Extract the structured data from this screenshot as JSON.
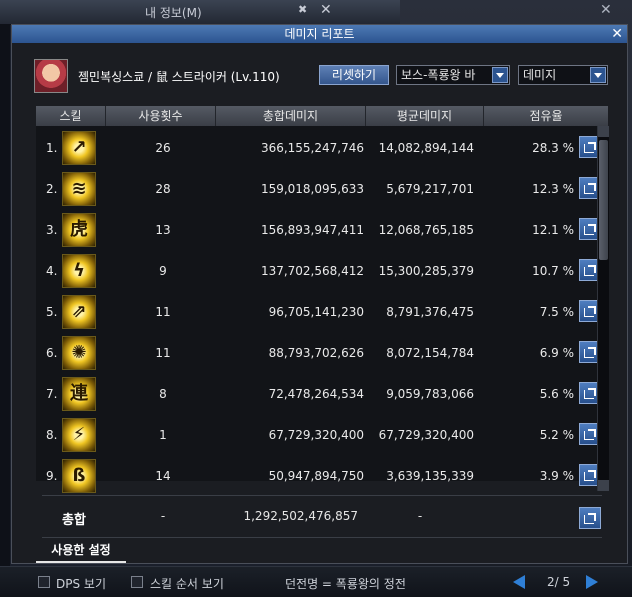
{
  "background": {
    "window_title": "내 정보(M)",
    "pin_glyph": "✖",
    "close_glyph": "✕",
    "right_close_glyph": "✕"
  },
  "bottom_bar": {
    "dps_label": "DPS 보기",
    "skill_order_label": "스킬 순서 보기",
    "dungeon_text": "던전명 = 폭룡왕의 정전",
    "page": "2/ 5"
  },
  "dialog": {
    "title": "데미지 리포트",
    "close": "✕",
    "character_name": "젬민복싱스쿄 / 鼠 스트라이커 (Lv.110)",
    "reset_button": "리셋하기",
    "boss_select": "보스-폭룡왕 바",
    "metric_select": "데미지"
  },
  "table": {
    "headers": [
      "스킬",
      "사용횟수",
      "총합데미지",
      "평균데미지",
      "점유율"
    ],
    "rows": [
      {
        "rank": "1.",
        "icon": "skill-icon-1",
        "uses": "26",
        "total": "366,155,247,746",
        "avg": "14,082,894,144",
        "share": "28.3 %"
      },
      {
        "rank": "2.",
        "icon": "skill-icon-2",
        "uses": "28",
        "total": "159,018,095,633",
        "avg": "5,679,217,701",
        "share": "12.3 %"
      },
      {
        "rank": "3.",
        "icon": "skill-icon-3",
        "uses": "13",
        "total": "156,893,947,411",
        "avg": "12,068,765,185",
        "share": "12.1 %"
      },
      {
        "rank": "4.",
        "icon": "skill-icon-4",
        "uses": "9",
        "total": "137,702,568,412",
        "avg": "15,300,285,379",
        "share": "10.7 %"
      },
      {
        "rank": "5.",
        "icon": "skill-icon-5",
        "uses": "11",
        "total": "96,705,141,230",
        "avg": "8,791,376,475",
        "share": "7.5 %"
      },
      {
        "rank": "6.",
        "icon": "skill-icon-6",
        "uses": "11",
        "total": "88,793,702,626",
        "avg": "8,072,154,784",
        "share": "6.9 %"
      },
      {
        "rank": "7.",
        "icon": "skill-icon-7",
        "uses": "8",
        "total": "72,478,264,534",
        "avg": "9,059,783,066",
        "share": "5.6 %"
      },
      {
        "rank": "8.",
        "icon": "skill-icon-8",
        "uses": "1",
        "total": "67,729,320,400",
        "avg": "67,729,320,400",
        "share": "5.2 %"
      },
      {
        "rank": "9.",
        "icon": "skill-icon-9",
        "uses": "14",
        "total": "50,947,894,750",
        "avg": "3,639,135,339",
        "share": "3.9 %"
      }
    ],
    "icon_glyphs": [
      "↗",
      "≋",
      "虎",
      "ϟ",
      "⇗",
      "✺",
      "連",
      "⚡",
      "ß"
    ]
  },
  "summary": {
    "label": "총합",
    "uses": "-",
    "total": "1,292,502,476,857",
    "avg": "-"
  },
  "tabs": {
    "settings": "사용한 설정"
  }
}
